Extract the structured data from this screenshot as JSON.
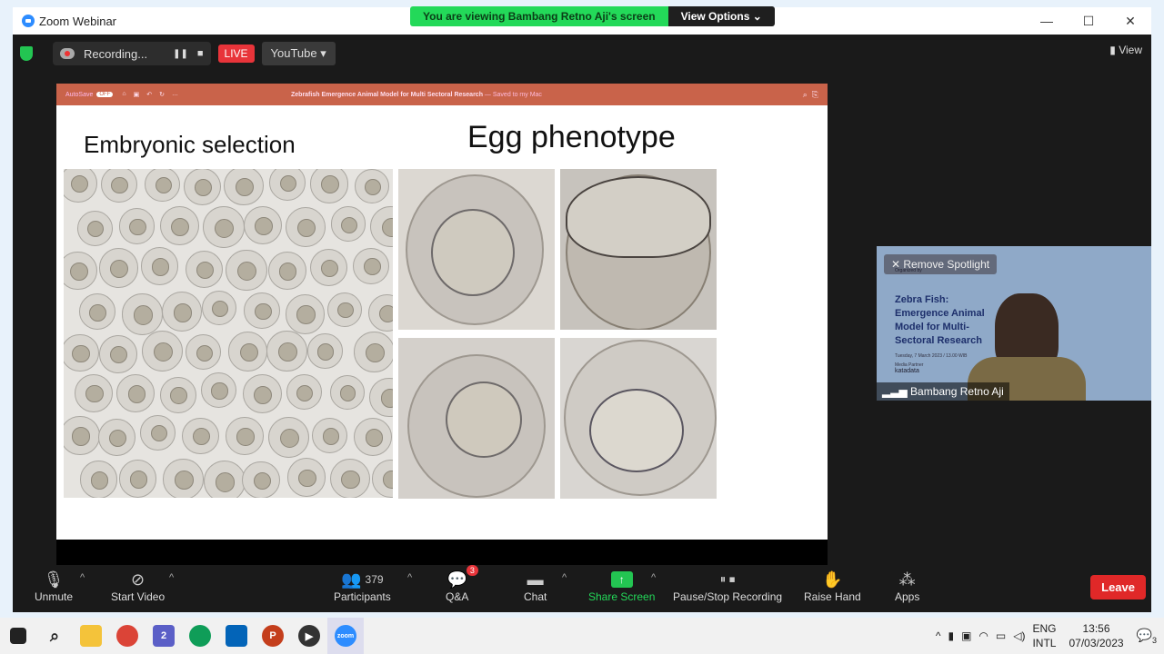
{
  "window": {
    "title": "Zoom Webinar",
    "min": "—",
    "max": "☐",
    "close": "✕"
  },
  "banner": {
    "message": "You are viewing Bambang Retno Aji's screen",
    "options": "View Options",
    "chevron": "⌄"
  },
  "topbar": {
    "recording": "Recording...",
    "pause": "❚❚",
    "stop": "■",
    "live": "LIVE",
    "stream": "YouTube ▾",
    "view": "View"
  },
  "slide": {
    "autosave": "AutoSave",
    "autosave_state": "OFF",
    "doc_title": "Zebrafish Emergence Animal Model for Multi Sectoral Research",
    "doc_saved": " — Saved to my Mac",
    "heading_left": "Embryonic selection",
    "heading_right": "Egg phenotype"
  },
  "spotlight": {
    "remove": "Remove Spotlight",
    "org_label": "Organized by",
    "title1": "Zebra Fish:",
    "title2": "Emergence Animal",
    "title3": "Model for Multi-",
    "title4": "Sectoral Research",
    "date": "Tuesday, 7 March 2023 / 13.00 WIB",
    "media": "Media Partner",
    "partner": "katadata",
    "name": "Bambang Retno Aji"
  },
  "toolbar": {
    "unmute": "Unmute",
    "start_video": "Start Video",
    "participants": "Participants",
    "participants_count": "379",
    "qa": "Q&A",
    "qa_badge": "3",
    "chat": "Chat",
    "share": "Share Screen",
    "pause_rec": "Pause/Stop Recording",
    "raise": "Raise Hand",
    "apps": "Apps",
    "leave": "Leave"
  },
  "taskbar": {
    "lang1": "ENG",
    "lang2": "INTL",
    "time": "13:56",
    "date": "07/03/2023",
    "notif": "3",
    "teams_badge": "2",
    "zoom_label": "zoom",
    "powerpoint_label": "P"
  },
  "colors": {
    "accent_green": "#23d959",
    "live_red": "#e8343a",
    "leave_red": "#e02828",
    "ppt_bar": "#c9634a"
  }
}
